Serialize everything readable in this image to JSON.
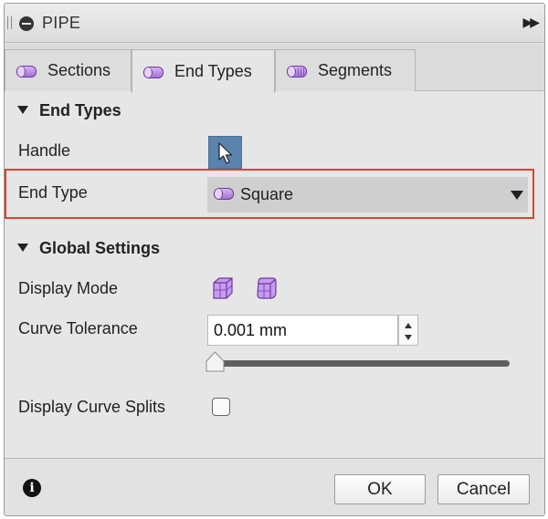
{
  "window": {
    "title": "PIPE"
  },
  "tabs": [
    {
      "label": "Sections",
      "icon": "cylinder-section-icon"
    },
    {
      "label": "End Types",
      "icon": "cylinder-endtype-icon",
      "active": true
    },
    {
      "label": "Segments",
      "icon": "cylinder-segments-icon"
    }
  ],
  "end_types": {
    "header": "End Types",
    "handle_label": "Handle",
    "end_type_label": "End Type",
    "end_type_value": "Square"
  },
  "global_settings": {
    "header": "Global Settings",
    "display_mode_label": "Display Mode",
    "curve_tolerance_label": "Curve Tolerance",
    "curve_tolerance_value": "0.001 mm",
    "display_curve_splits_label": "Display Curve Splits",
    "slider_fraction": 0.0,
    "display_curve_splits_checked": false
  },
  "footer": {
    "ok_label": "OK",
    "cancel_label": "Cancel",
    "info_glyph": "i"
  },
  "colors": {
    "highlight": "#e0412a",
    "handle_button": "#5a83ad",
    "accent_purple": "#a470d6"
  }
}
